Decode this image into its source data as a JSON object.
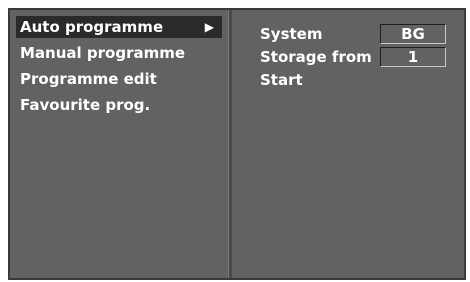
{
  "menu": {
    "items": [
      {
        "label": "Auto programme",
        "selected": true
      },
      {
        "label": "Manual programme",
        "selected": false
      },
      {
        "label": "Programme edit",
        "selected": false
      },
      {
        "label": "Favourite prog.",
        "selected": false
      }
    ],
    "arrow_icon": "right-triangle-icon"
  },
  "settings": {
    "system": {
      "label": "System",
      "value": "BG"
    },
    "storage_from": {
      "label": "Storage from",
      "value": "1"
    },
    "start": {
      "label": "Start"
    }
  },
  "colors": {
    "background": "#626262",
    "selection": "#2a2a2a",
    "text": "#ffffff"
  }
}
